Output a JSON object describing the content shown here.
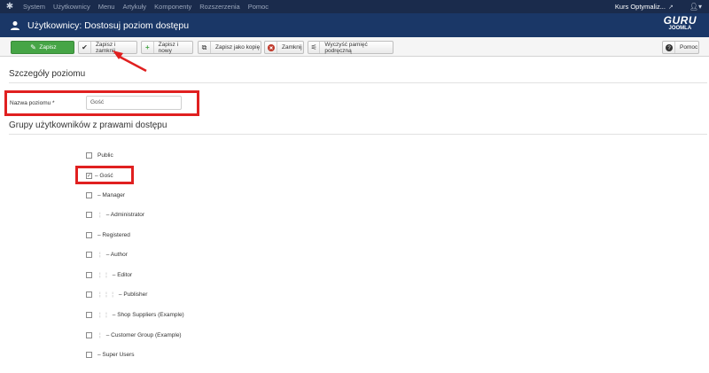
{
  "topbar": {
    "menu": [
      "System",
      "Użytkownicy",
      "Menu",
      "Artykuły",
      "Komponenty",
      "Rozszerzenia",
      "Pomoc"
    ],
    "site_name": "Kurs Optymaliz...",
    "external_icon": "external-link-icon",
    "user_icon": "user-icon"
  },
  "header": {
    "title": "Użytkownicy: Dostosuj poziom dostępu",
    "brand_line1": "GURU",
    "brand_line2": "JOOMLA"
  },
  "toolbar": {
    "save": "Zapisz",
    "save_close": "Zapisz i zamknij",
    "save_new": "Zapisz i nowy",
    "save_copy": "Zapisz jako kopię",
    "close": "Zamknij",
    "clear_cache": "Wyczyść pamięć podręczną",
    "help": "Pomoc"
  },
  "details": {
    "section_title": "Szczegóły poziomu",
    "name_label": "Nazwa poziomu *",
    "name_value": "Gość"
  },
  "groups": {
    "section_title": "Grupy użytkowników z prawami dostępu",
    "items": [
      {
        "label": "Public",
        "prefix": "",
        "checked": false
      },
      {
        "label": "– Gość",
        "prefix": "",
        "checked": true
      },
      {
        "label": "– Manager",
        "prefix": "",
        "checked": false
      },
      {
        "label": "– Administrator",
        "prefix": "¦",
        "checked": false
      },
      {
        "label": "– Registered",
        "prefix": "",
        "checked": false
      },
      {
        "label": "– Author",
        "prefix": "¦",
        "checked": false
      },
      {
        "label": "– Editor",
        "prefix": "¦   ¦",
        "checked": false
      },
      {
        "label": "– Publisher",
        "prefix": "¦   ¦   ¦",
        "checked": false
      },
      {
        "label": "– Shop Suppliers (Example)",
        "prefix": "¦   ¦",
        "checked": false
      },
      {
        "label": "– Customer Group (Example)",
        "prefix": "¦",
        "checked": false
      },
      {
        "label": "– Super Users",
        "prefix": "",
        "checked": false
      }
    ]
  },
  "colors": {
    "topbar": "#1a2b4c",
    "header": "#1a3767",
    "save_green": "#46a546",
    "annotation_red": "#e02020"
  }
}
